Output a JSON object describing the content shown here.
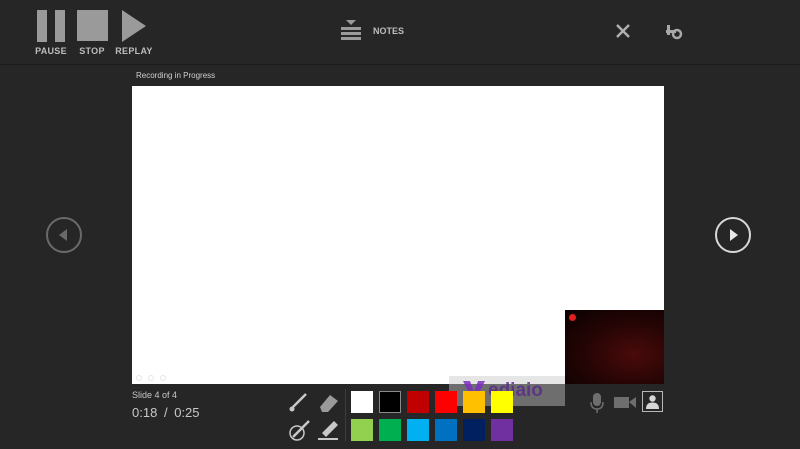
{
  "toolbar": {
    "pause_label": "PAUSE",
    "stop_label": "STOP",
    "replay_label": "REPLAY",
    "notes_label": "NOTES"
  },
  "status": {
    "recording_text": "Recording in Progress",
    "slide_counter": "Slide 4 of 4",
    "time_current": "0:18",
    "time_separator": "/",
    "time_total": "0:25"
  },
  "watermark": "ediaio",
  "colors": {
    "background": "#262626",
    "recording_dot": "#e02020",
    "palette_row1": [
      "#ffffff",
      "#000000",
      "#c00000",
      "#ff0000",
      "#ffc000",
      "#ffff00"
    ],
    "palette_row2": [
      "#92d050",
      "#00b050",
      "#00b0f0",
      "#0070c0",
      "#002060",
      "#7030a0"
    ]
  },
  "icons": {
    "close": "close-icon",
    "settings": "settings-icon",
    "prev": "previous-slide-icon",
    "next": "next-slide-icon",
    "pen": "pen-icon",
    "eraser": "eraser-icon",
    "laser": "laser-pointer-icon",
    "highlighter": "highlighter-icon",
    "mic": "microphone-icon",
    "camera": "camera-icon",
    "camera_preview": "camera-preview-icon"
  }
}
